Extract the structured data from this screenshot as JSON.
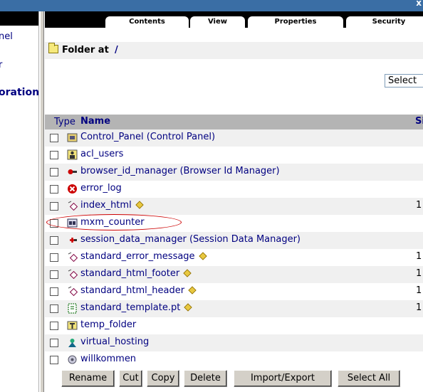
{
  "window": {
    "close_glyph": "x"
  },
  "left_nav": {
    "items": [
      {
        "label": "nel",
        "bold": false
      },
      {
        "label": "r",
        "bold": false
      },
      {
        "label": "oration",
        "bold": true
      }
    ]
  },
  "tabs": [
    {
      "label": "Contents",
      "active": true
    },
    {
      "label": "View",
      "active": false
    },
    {
      "label": "Properties",
      "active": false
    },
    {
      "label": "Security",
      "active": false
    }
  ],
  "location": {
    "label": "Folder at",
    "path": "/"
  },
  "add_select": {
    "value": "Select"
  },
  "table": {
    "col_type": "Type",
    "col_name": "Name",
    "col_size": "Si",
    "rows": [
      {
        "name": "Control_Panel (Control Panel)",
        "icon": "control-panel-icon",
        "editable": false,
        "size": ""
      },
      {
        "name": "acl_users",
        "icon": "user-folder-icon",
        "editable": false,
        "size": ""
      },
      {
        "name": "browser_id_manager (Browser Id Manager)",
        "icon": "browser-id-manager-icon",
        "editable": false,
        "size": ""
      },
      {
        "name": "error_log",
        "icon": "error-log-icon",
        "editable": false,
        "size": ""
      },
      {
        "name": "index_html",
        "icon": "dtml-method-icon",
        "editable": true,
        "size": "1"
      },
      {
        "name": "mxm_counter",
        "icon": "counter-icon",
        "editable": false,
        "size": ""
      },
      {
        "name": "session_data_manager (Session Data Manager)",
        "icon": "session-data-manager-icon",
        "editable": false,
        "size": ""
      },
      {
        "name": "standard_error_message",
        "icon": "dtml-method-icon",
        "editable": true,
        "size": "1"
      },
      {
        "name": "standard_html_footer",
        "icon": "dtml-method-icon",
        "editable": true,
        "size": "1"
      },
      {
        "name": "standard_html_header",
        "icon": "dtml-method-icon",
        "editable": true,
        "size": "1"
      },
      {
        "name": "standard_template.pt",
        "icon": "page-template-icon",
        "editable": true,
        "size": "1"
      },
      {
        "name": "temp_folder",
        "icon": "temp-folder-icon",
        "editable": false,
        "size": ""
      },
      {
        "name": "virtual_hosting",
        "icon": "virtual-host-monster-icon",
        "editable": false,
        "size": ""
      },
      {
        "name": "willkommen",
        "icon": "dtml-document-icon",
        "editable": false,
        "size": ""
      }
    ]
  },
  "buttons": {
    "rename": "Rename",
    "cut": "Cut",
    "copy": "Copy",
    "delete": "Delete",
    "import_export": "Import/Export",
    "select_all": "Select All"
  },
  "colors": {
    "link": "#000080",
    "header_bg": "#b4b4b4",
    "annotation": "#cc0000"
  }
}
